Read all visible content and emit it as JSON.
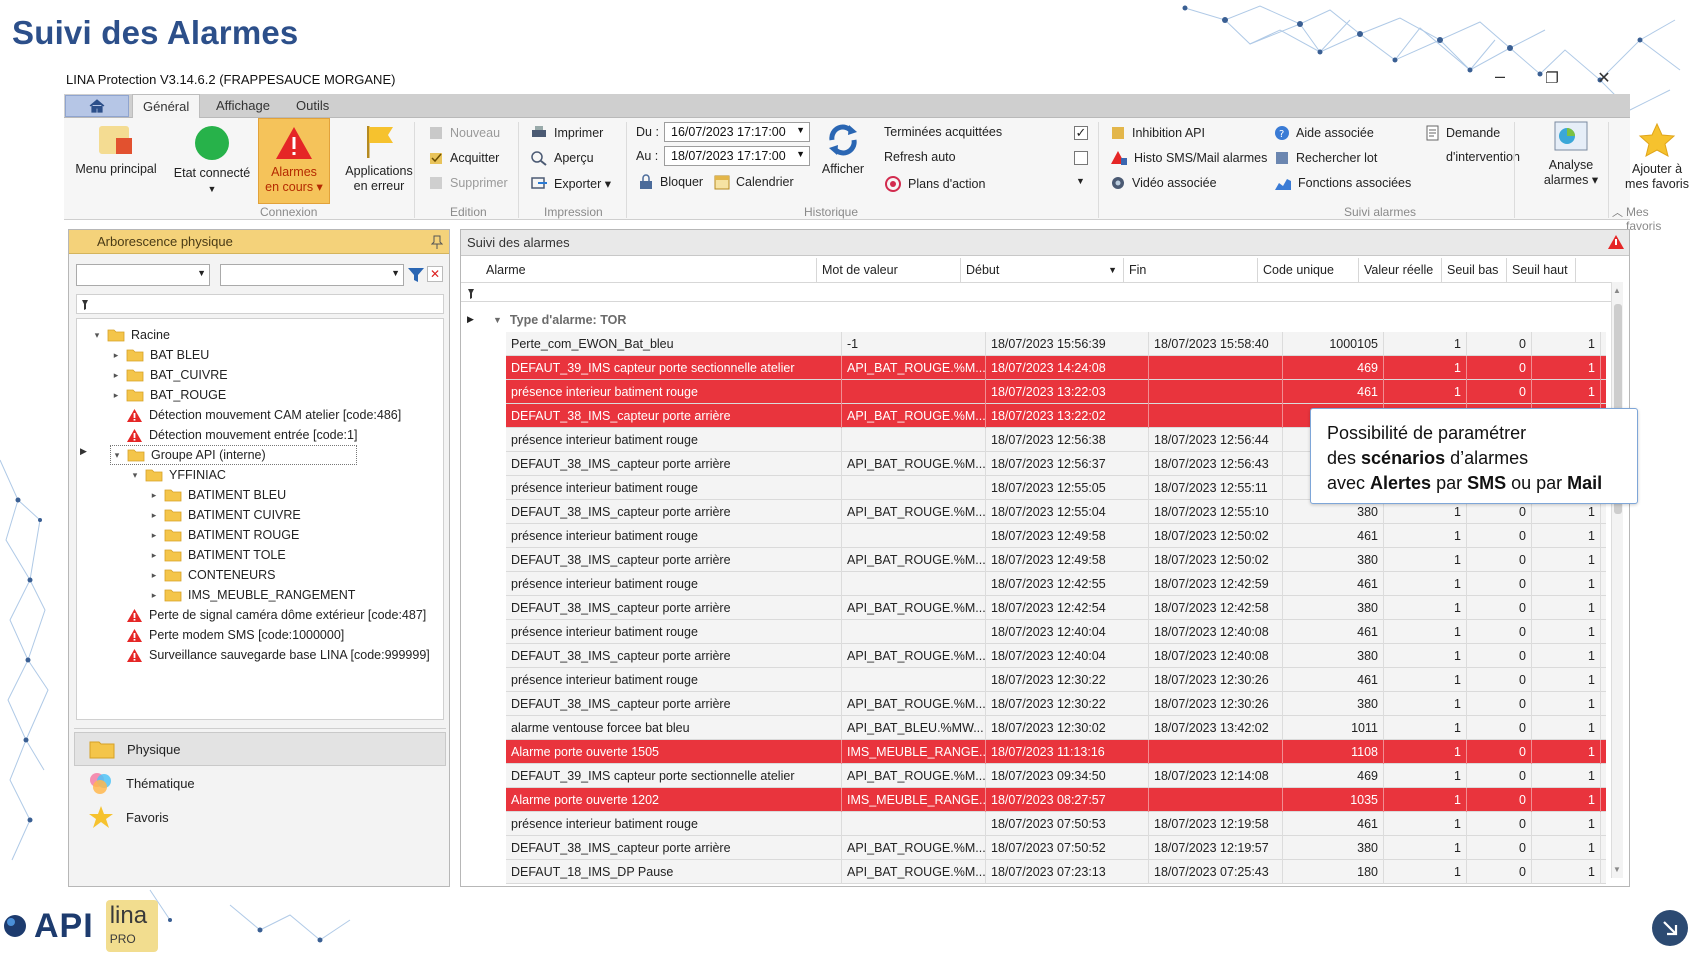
{
  "slide": {
    "title": "Suivi des Alarmes",
    "callout_parts": [
      {
        "t": "Possibilité de paramétrer",
        "b": false,
        "br": true
      },
      {
        "t": "des ",
        "b": false
      },
      {
        "t": "scénarios",
        "b": true
      },
      {
        "t": " d’alarmes",
        "b": false,
        "br": true
      },
      {
        "t": "avec ",
        "b": false
      },
      {
        "t": "Alertes",
        "b": true
      },
      {
        "t": " par ",
        "b": false
      },
      {
        "t": "SMS",
        "b": true
      },
      {
        "t": " ou par ",
        "b": false
      },
      {
        "t": "Mail",
        "b": true
      }
    ],
    "logo_api": "API",
    "logo_lina": "lina",
    "logo_lina_sub": "PRO"
  },
  "app": {
    "title": "LINA Protection  V3.14.6.2  (FRAPPESAUCE MORGANE)",
    "window_controls": {
      "minimize": "–",
      "restore": "❐",
      "close": "✕"
    }
  },
  "menu": {
    "tabs": [
      "Général",
      "Affichage",
      "Outils"
    ],
    "active": 0
  },
  "ribbon": {
    "menu_principal": "Menu principal",
    "etat_connecte": "Etat connecté",
    "alarmes_en_cours_1": "Alarmes",
    "alarmes_en_cours_2": "en cours ▾",
    "applications_1": "Applications",
    "applications_2": "en erreur",
    "nouveau": "Nouveau",
    "acquitter": "Acquitter",
    "supprimer": "Supprimer",
    "imprimer": "Imprimer",
    "apercu": "Aperçu",
    "exporter": "Exporter ▾",
    "du_label": "Du :",
    "du_value": "16/07/2023 17:17:00",
    "au_label": "Au :",
    "au_value": "18/07/2023 17:17:00",
    "bloquer": "Bloquer",
    "calendrier": "Calendrier",
    "afficher": "Afficher",
    "terminees_acquittees": "Terminées acquittées",
    "refresh_auto": "Refresh auto",
    "plans_action": "Plans d'action",
    "inhibition_api": "Inhibition API",
    "histo_sms": "Histo SMS/Mail alarmes",
    "video_associee": "Vidéo associée",
    "aide_associee": "Aide associée",
    "rechercher_lot": "Rechercher lot",
    "fonctions_associees": "Fonctions associées",
    "demande_1": "Demande",
    "demande_2": "d'intervention",
    "analyse_1": "Analyse",
    "analyse_2": "alarmes ▾",
    "favoris_1": "Ajouter à",
    "favoris_2": "mes favoris",
    "groups": {
      "connexion": "Connexion",
      "edition": "Edition",
      "impression": "Impression",
      "historique": "Historique",
      "suivi_alarmes": "Suivi alarmes",
      "mes_favoris": "Mes favoris"
    }
  },
  "left_panel": {
    "title": "Arborescence physique",
    "tree": [
      {
        "label": "Racine",
        "level": 0,
        "type": "folder",
        "exp": "▾"
      },
      {
        "label": "BAT BLEU",
        "level": 1,
        "type": "folder",
        "exp": "▸"
      },
      {
        "label": "BAT_CUIVRE",
        "level": 1,
        "type": "folder",
        "exp": "▸"
      },
      {
        "label": "BAT_ROUGE",
        "level": 1,
        "type": "folder",
        "exp": "▸"
      },
      {
        "label": "Détection mouvement CAM atelier [code:486]",
        "level": 1,
        "type": "alarm",
        "exp": ""
      },
      {
        "label": "Détection mouvement entrée [code:1]",
        "level": 1,
        "type": "alarm",
        "exp": ""
      },
      {
        "label": "Groupe API (interne)",
        "level": 1,
        "type": "folder",
        "exp": "▾",
        "selected": true
      },
      {
        "label": "YFFINIAC",
        "level": 2,
        "type": "folder",
        "exp": "▾"
      },
      {
        "label": "BATIMENT BLEU",
        "level": 3,
        "type": "folder",
        "exp": "▸"
      },
      {
        "label": "BATIMENT CUIVRE",
        "level": 3,
        "type": "folder",
        "exp": "▸"
      },
      {
        "label": "BATIMENT ROUGE",
        "level": 3,
        "type": "folder",
        "exp": "▸"
      },
      {
        "label": "BATIMENT TOLE",
        "level": 3,
        "type": "folder",
        "exp": "▸"
      },
      {
        "label": "CONTENEURS",
        "level": 3,
        "type": "folder",
        "exp": "▸"
      },
      {
        "label": "IMS_MEUBLE_RANGEMENT",
        "level": 3,
        "type": "folder",
        "exp": "▸"
      },
      {
        "label": "Perte de signal caméra dôme extérieur [code:487]",
        "level": 1,
        "type": "alarm",
        "exp": ""
      },
      {
        "label": "Perte modem SMS [code:1000000]",
        "level": 1,
        "type": "alarm",
        "exp": ""
      },
      {
        "label": "Surveillance sauvegarde base LINA [code:999999]",
        "level": 1,
        "type": "alarm",
        "exp": ""
      }
    ],
    "nav": [
      {
        "label": "Physique",
        "icon": "folder-icon",
        "active": true
      },
      {
        "label": "Thématique",
        "icon": "thematic-icon",
        "active": false
      },
      {
        "label": "Favoris",
        "icon": "star-icon",
        "active": false
      }
    ]
  },
  "right_panel": {
    "title": "Suivi des alarmes",
    "columns": [
      "Alarme",
      "Mot de valeur",
      "Début",
      "Fin",
      "Code unique",
      "Valeur réelle",
      "Seuil bas",
      "Seuil haut"
    ],
    "group_label": "Type d'alarme: TOR",
    "rows": [
      {
        "alarme": "Perte_com_EWON_Bat_bleu",
        "mot": "-1",
        "debut": "18/07/2023 15:56:39",
        "fin": "18/07/2023 15:58:40",
        "code": "1000105",
        "valeur": "1",
        "bas": "0",
        "haut": "1",
        "red": false
      },
      {
        "alarme": "DEFAUT_39_IMS capteur porte sectionnelle atelier",
        "mot": "API_BAT_ROUGE.%M...",
        "debut": "18/07/2023 14:24:08",
        "fin": "",
        "code": "469",
        "valeur": "1",
        "bas": "0",
        "haut": "1",
        "red": true
      },
      {
        "alarme": "présence interieur batiment rouge",
        "mot": "",
        "debut": "18/07/2023 13:22:03",
        "fin": "",
        "code": "461",
        "valeur": "1",
        "bas": "0",
        "haut": "1",
        "red": true
      },
      {
        "alarme": "DEFAUT_38_IMS_capteur porte arrière",
        "mot": "API_BAT_ROUGE.%M...",
        "debut": "18/07/2023 13:22:02",
        "fin": "",
        "code": "380",
        "valeur": "1",
        "bas": "0",
        "haut": "1",
        "red": true
      },
      {
        "alarme": "présence interieur batiment rouge",
        "mot": "",
        "debut": "18/07/2023 12:56:38",
        "fin": "18/07/2023 12:56:44",
        "code": "461",
        "valeur": "1",
        "bas": "0",
        "haut": "1",
        "red": false
      },
      {
        "alarme": "DEFAUT_38_IMS_capteur porte arrière",
        "mot": "API_BAT_ROUGE.%M...",
        "debut": "18/07/2023 12:56:37",
        "fin": "18/07/2023 12:56:43",
        "code": "380",
        "valeur": "1",
        "bas": "0",
        "haut": "1",
        "red": false
      },
      {
        "alarme": "présence interieur batiment rouge",
        "mot": "",
        "debut": "18/07/2023 12:55:05",
        "fin": "18/07/2023 12:55:11",
        "code": "461",
        "valeur": "1",
        "bas": "0",
        "haut": "1",
        "red": false
      },
      {
        "alarme": "DEFAUT_38_IMS_capteur porte arrière",
        "mot": "API_BAT_ROUGE.%M...",
        "debut": "18/07/2023 12:55:04",
        "fin": "18/07/2023 12:55:10",
        "code": "380",
        "valeur": "1",
        "bas": "0",
        "haut": "1",
        "red": false
      },
      {
        "alarme": "présence interieur batiment rouge",
        "mot": "",
        "debut": "18/07/2023 12:49:58",
        "fin": "18/07/2023 12:50:02",
        "code": "461",
        "valeur": "1",
        "bas": "0",
        "haut": "1",
        "red": false
      },
      {
        "alarme": "DEFAUT_38_IMS_capteur porte arrière",
        "mot": "API_BAT_ROUGE.%M...",
        "debut": "18/07/2023 12:49:58",
        "fin": "18/07/2023 12:50:02",
        "code": "380",
        "valeur": "1",
        "bas": "0",
        "haut": "1",
        "red": false
      },
      {
        "alarme": "présence interieur batiment rouge",
        "mot": "",
        "debut": "18/07/2023 12:42:55",
        "fin": "18/07/2023 12:42:59",
        "code": "461",
        "valeur": "1",
        "bas": "0",
        "haut": "1",
        "red": false
      },
      {
        "alarme": "DEFAUT_38_IMS_capteur porte arrière",
        "mot": "API_BAT_ROUGE.%M...",
        "debut": "18/07/2023 12:42:54",
        "fin": "18/07/2023 12:42:58",
        "code": "380",
        "valeur": "1",
        "bas": "0",
        "haut": "1",
        "red": false
      },
      {
        "alarme": "présence interieur batiment rouge",
        "mot": "",
        "debut": "18/07/2023 12:40:04",
        "fin": "18/07/2023 12:40:08",
        "code": "461",
        "valeur": "1",
        "bas": "0",
        "haut": "1",
        "red": false
      },
      {
        "alarme": "DEFAUT_38_IMS_capteur porte arrière",
        "mot": "API_BAT_ROUGE.%M...",
        "debut": "18/07/2023 12:40:04",
        "fin": "18/07/2023 12:40:08",
        "code": "380",
        "valeur": "1",
        "bas": "0",
        "haut": "1",
        "red": false
      },
      {
        "alarme": "présence interieur batiment rouge",
        "mot": "",
        "debut": "18/07/2023 12:30:22",
        "fin": "18/07/2023 12:30:26",
        "code": "461",
        "valeur": "1",
        "bas": "0",
        "haut": "1",
        "red": false
      },
      {
        "alarme": "DEFAUT_38_IMS_capteur porte arrière",
        "mot": "API_BAT_ROUGE.%M...",
        "debut": "18/07/2023 12:30:22",
        "fin": "18/07/2023 12:30:26",
        "code": "380",
        "valeur": "1",
        "bas": "0",
        "haut": "1",
        "red": false
      },
      {
        "alarme": "alarme ventouse forcee  bat bleu",
        "mot": "API_BAT_BLEU.%MW...",
        "debut": "18/07/2023 12:30:02",
        "fin": "18/07/2023 13:42:02",
        "code": "1011",
        "valeur": "1",
        "bas": "0",
        "haut": "1",
        "red": false
      },
      {
        "alarme": "Alarme porte ouverte 1505",
        "mot": "IMS_MEUBLE_RANGE...",
        "debut": "18/07/2023 11:13:16",
        "fin": "",
        "code": "1108",
        "valeur": "1",
        "bas": "0",
        "haut": "1",
        "red": true
      },
      {
        "alarme": "DEFAUT_39_IMS capteur porte sectionnelle atelier",
        "mot": "API_BAT_ROUGE.%M...",
        "debut": "18/07/2023 09:34:50",
        "fin": "18/07/2023 12:14:08",
        "code": "469",
        "valeur": "1",
        "bas": "0",
        "haut": "1",
        "red": false
      },
      {
        "alarme": "Alarme porte ouverte 1202",
        "mot": "IMS_MEUBLE_RANGE...",
        "debut": "18/07/2023 08:27:57",
        "fin": "",
        "code": "1035",
        "valeur": "1",
        "bas": "0",
        "haut": "1",
        "red": true
      },
      {
        "alarme": "présence interieur batiment rouge",
        "mot": "",
        "debut": "18/07/2023 07:50:53",
        "fin": "18/07/2023 12:19:58",
        "code": "461",
        "valeur": "1",
        "bas": "0",
        "haut": "1",
        "red": false
      },
      {
        "alarme": "DEFAUT_38_IMS_capteur porte arrière",
        "mot": "API_BAT_ROUGE.%M...",
        "debut": "18/07/2023 07:50:52",
        "fin": "18/07/2023 12:19:57",
        "code": "380",
        "valeur": "1",
        "bas": "0",
        "haut": "1",
        "red": false
      },
      {
        "alarme": "DEFAUT_18_IMS_DP Pause",
        "mot": "API_BAT_ROUGE.%M...",
        "debut": "18/07/2023 07:23:13",
        "fin": "18/07/2023 07:25:43",
        "code": "180",
        "valeur": "1",
        "bas": "0",
        "haut": "1",
        "red": false
      }
    ]
  },
  "colors": {
    "title_blue": "#2c4f8a",
    "alarm_red": "#e9343d",
    "panel_header_yellow": "#f4d27a",
    "callout_border": "#7ea6d8"
  }
}
